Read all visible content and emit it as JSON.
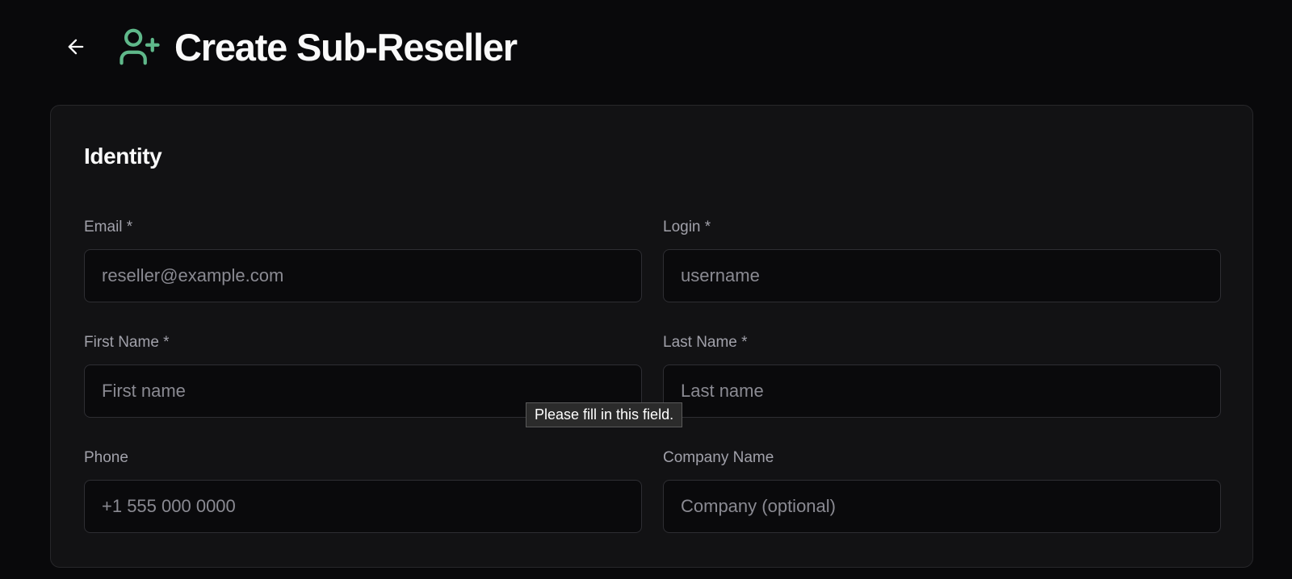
{
  "header": {
    "title": "Create Sub-Reseller",
    "back_icon": "arrow-left-icon",
    "title_icon": "user-plus-icon",
    "accent_color": "#5fb88a"
  },
  "identity": {
    "title": "Identity",
    "fields": {
      "email": {
        "label": "Email *",
        "placeholder": "reseller@example.com",
        "value": ""
      },
      "login": {
        "label": "Login *",
        "placeholder": "username",
        "value": ""
      },
      "first_name": {
        "label": "First Name *",
        "placeholder": "First name",
        "value": ""
      },
      "last_name": {
        "label": "Last Name *",
        "placeholder": "Last name",
        "value": ""
      },
      "phone": {
        "label": "Phone",
        "placeholder": "+1 555 000 0000",
        "value": ""
      },
      "company_name": {
        "label": "Company Name",
        "placeholder": "Company (optional)",
        "value": ""
      }
    }
  },
  "validation_tooltip": "Please fill in this field."
}
